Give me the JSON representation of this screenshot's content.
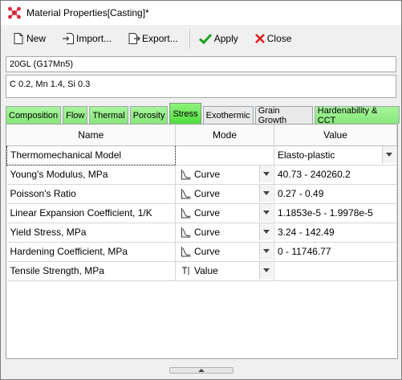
{
  "window": {
    "title": "Material Properties[Casting]*"
  },
  "toolbar": {
    "new_label": "New",
    "import_label": "Import...",
    "export_label": "Export...",
    "apply_label": "Apply",
    "close_label": "Close"
  },
  "material": {
    "name": "20GL (G17Mn5)",
    "composition": "C 0.2, Mn 1.4, Si 0.3"
  },
  "tabs": [
    "Composition",
    "Flow",
    "Thermal",
    "Porosity",
    "Stress",
    "Exothermic",
    "Grain Growth",
    "Hardenability & CCT"
  ],
  "active_tab": "Stress",
  "table": {
    "headers": {
      "name": "Name",
      "mode": "Mode",
      "value": "Value"
    },
    "rows": [
      {
        "name": "Thermomechanical Model",
        "mode": "",
        "mode_icon": "",
        "value": "Elasto-plastic"
      },
      {
        "name": "Young's Modulus, MPa",
        "mode": "Curve",
        "mode_icon": "curve-icon",
        "value": "40.73 - 240260.2"
      },
      {
        "name": "Poisson's Ratio",
        "mode": "Curve",
        "mode_icon": "curve-icon",
        "value": "0.27 - 0.49"
      },
      {
        "name": "Linear Expansion Coefficient, 1/K",
        "mode": "Curve",
        "mode_icon": "curve-icon",
        "value": "1.1853e-5 - 1.9978e-5"
      },
      {
        "name": "Yield Stress, MPa",
        "mode": "Curve",
        "mode_icon": "curve-icon",
        "value": "3.24 - 142.49"
      },
      {
        "name": "Hardening Coefficient, MPa",
        "mode": "Curve",
        "mode_icon": "curve-icon",
        "value": "0 - 11746.77"
      },
      {
        "name": "Tensile Strength, MPa",
        "mode": "Value",
        "mode_icon": "text-value-icon",
        "value": ""
      }
    ]
  },
  "colors": {
    "tab_green": "#86e67a",
    "tab_active": "#4fdf3c",
    "apply_check": "#1aa31a",
    "close_x": "#e02020"
  }
}
